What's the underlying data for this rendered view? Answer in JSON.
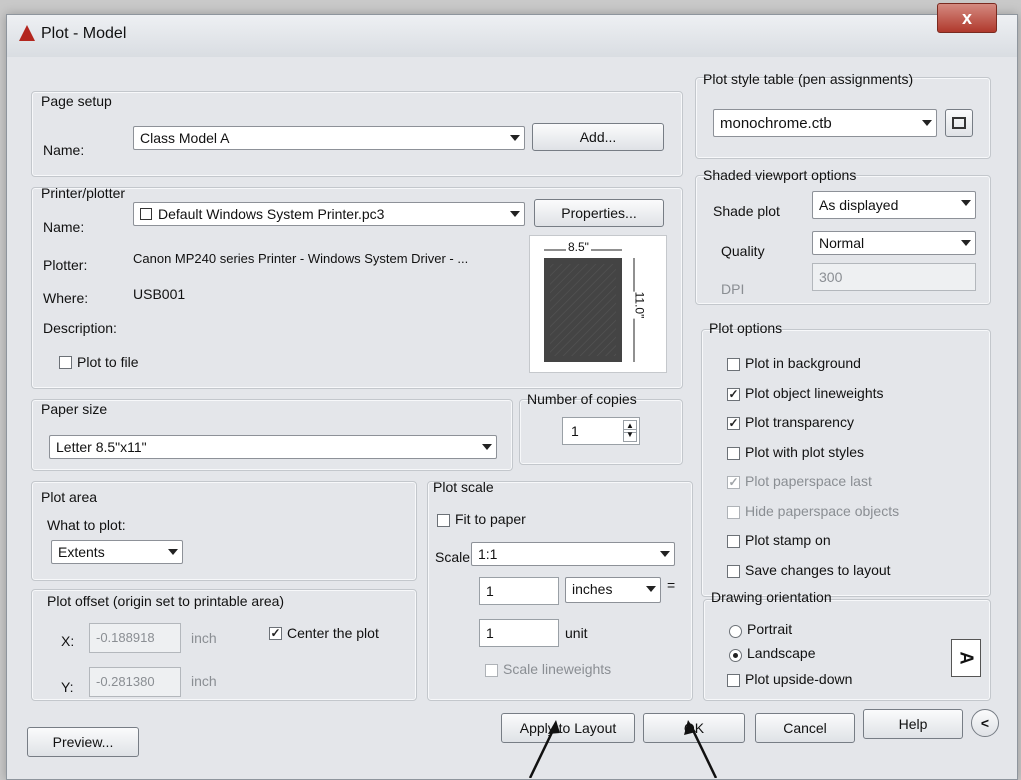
{
  "window": {
    "title": "Plot - Model",
    "close_label": "x"
  },
  "page_setup": {
    "group_label": "Page setup",
    "name_label": "Name:",
    "name_value": "Class Model A",
    "add_button": "Add..."
  },
  "printer": {
    "group_label": "Printer/plotter",
    "name_label": "Name:",
    "name_value": "Default Windows System Printer.pc3",
    "properties_button": "Properties...",
    "plotter_label": "Plotter:",
    "plotter_value": "Canon MP240 series Printer - Windows System Driver - ...",
    "where_label": "Where:",
    "where_value": "USB001",
    "description_label": "Description:",
    "plot_to_file_label": "Plot to file",
    "plot_to_file_checked": false,
    "preview_width_label": "8.5\"",
    "preview_height_label": "11.0\""
  },
  "paper_size": {
    "group_label": "Paper size",
    "value": "Letter 8.5\"x11\""
  },
  "copies": {
    "group_label": "Number of copies",
    "value": "1"
  },
  "plot_area": {
    "group_label": "Plot area",
    "what_label": "What to plot:",
    "what_value": "Extents"
  },
  "plot_offset": {
    "group_label": "Plot offset (origin set to printable area)",
    "x_label": "X:",
    "x_value": "-0.188918",
    "x_unit": "inch",
    "y_label": "Y:",
    "y_value": "-0.281380",
    "y_unit": "inch",
    "center_label": "Center the plot",
    "center_checked": true
  },
  "plot_scale": {
    "group_label": "Plot scale",
    "fit_label": "Fit to paper",
    "fit_checked": false,
    "scale_label": "Scale:",
    "scale_value": "1:1",
    "value1": "1",
    "unit1": "inches",
    "equals": "=",
    "value2": "1",
    "unit2": "unit",
    "lineweights_label": "Scale lineweights",
    "lineweights_checked": false
  },
  "plot_style_table": {
    "group_label": "Plot style table (pen assignments)",
    "value": "monochrome.ctb"
  },
  "shaded_viewport": {
    "group_label": "Shaded viewport options",
    "shade_label": "Shade plot",
    "shade_value": "As displayed",
    "quality_label": "Quality",
    "quality_value": "Normal",
    "dpi_label": "DPI",
    "dpi_value": "300"
  },
  "plot_options": {
    "group_label": "Plot options",
    "items": [
      {
        "label": "Plot in background",
        "checked": false,
        "disabled": false
      },
      {
        "label": "Plot object lineweights",
        "checked": true,
        "disabled": false
      },
      {
        "label": "Plot transparency",
        "checked": true,
        "disabled": false
      },
      {
        "label": "Plot with plot styles",
        "checked": false,
        "disabled": false
      },
      {
        "label": "Plot paperspace last",
        "checked": true,
        "disabled": true
      },
      {
        "label": "Hide paperspace objects",
        "checked": false,
        "disabled": true
      },
      {
        "label": "Plot stamp on",
        "checked": false,
        "disabled": false
      },
      {
        "label": "Save changes to layout",
        "checked": false,
        "disabled": false
      }
    ]
  },
  "drawing_orientation": {
    "group_label": "Drawing orientation",
    "portrait_label": "Portrait",
    "landscape_label": "Landscape",
    "selected": "Landscape",
    "upside_down_label": "Plot upside-down",
    "upside_down_checked": false,
    "orientation_glyph": "A"
  },
  "buttons": {
    "preview": "Preview...",
    "apply": "Apply to Layout",
    "ok": "OK",
    "cancel": "Cancel",
    "help": "Help",
    "collapse_glyph": "<"
  }
}
